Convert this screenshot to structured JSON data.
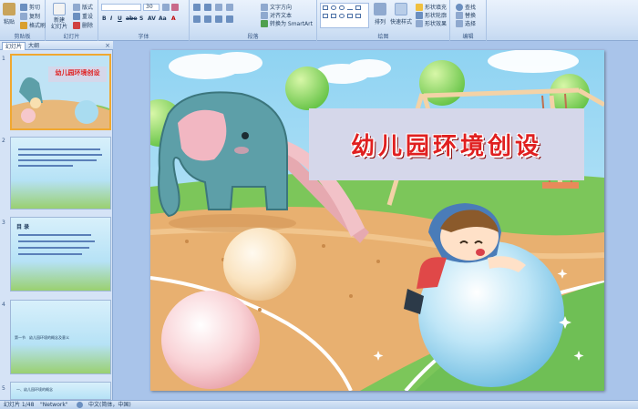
{
  "ribbon": {
    "clipboard": {
      "label": "剪贴板",
      "paste": "粘贴",
      "cut": "剪切",
      "copy": "复制",
      "format_painter": "格式刷"
    },
    "slides": {
      "label": "幻灯片",
      "new_slide": "新建\n幻灯片",
      "layout": "版式",
      "reset": "重设",
      "delete": "删除"
    },
    "font": {
      "label": "字体",
      "font_size": "30",
      "bold": "B",
      "italic": "I",
      "underline": "U",
      "strike": "abe",
      "shadow": "S",
      "spacing": "AV",
      "change_case": "Aa",
      "font_color": "A"
    },
    "paragraph": {
      "label": "段落",
      "text_direction": "文字方向",
      "align_text": "对齐文本",
      "convert_smartart": "转换为 SmartArt"
    },
    "drawing": {
      "label": "绘图",
      "arrange": "排列",
      "quick_styles": "快速样式",
      "shape_fill": "形状填充",
      "shape_outline": "形状轮廓",
      "shape_effects": "形状效果"
    },
    "editing": {
      "label": "编辑",
      "find": "查找",
      "replace": "替换",
      "select": "选择"
    }
  },
  "left_pane": {
    "tabs": [
      "幻灯片",
      "大纲"
    ],
    "close_glyph": "×",
    "thumbnails": [
      {
        "number": "1",
        "text": "幼儿园环境创设"
      },
      {
        "number": "2",
        "text": ""
      },
      {
        "number": "3",
        "text": "目 录"
      },
      {
        "number": "4",
        "text": "第一节　幼儿园环境的概念及意义"
      },
      {
        "number": "5",
        "text": "一、幼儿园环境的概念"
      }
    ]
  },
  "slide": {
    "title": "幼儿园环境创设"
  },
  "status_bar": {
    "slide_counter": "幻灯片 1/48",
    "theme": "\"Network\"",
    "language": "中文(简体，中国)"
  },
  "colors": {
    "ribbon_bg": "#d6e5f7",
    "accent": "#1e395b",
    "title_red": "#e02020",
    "selected_thumb": "#f0a830"
  }
}
